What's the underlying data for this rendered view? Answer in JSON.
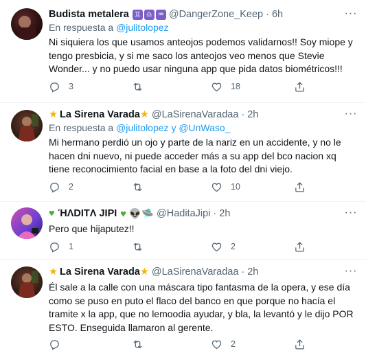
{
  "tweets": [
    {
      "name": "Budista metalera",
      "name_suffix_badges": [
        "♊",
        "♎",
        "♒"
      ],
      "handle": "@DangerZone_Keep",
      "time": "6h",
      "reply_prefix": "En respuesta a",
      "reply_to": [
        "@julitolopez"
      ],
      "reply_joiner": "",
      "text": "Ni siquiera los que usamos anteojos podemos validarnos!! Soy miope y tengo presbicia, y si me saco los anteojos veo menos que Stevie Wonder... y no puedo usar ninguna app que pida datos biométricos!!!",
      "replies": "3",
      "retweets": "",
      "likes": "18"
    },
    {
      "name_prefix": "★",
      "name": "La Sirena Varada",
      "name_suffix": "★",
      "handle": "@LaSirenaVaradaa",
      "time": "2h",
      "reply_prefix": "En respuesta a",
      "reply_to": [
        "@julitolopez",
        "@UnWaso_"
      ],
      "reply_joiner": "y",
      "text": "Mi hermano perdió un ojo y parte de la nariz en un accidente, y no le hacen dni nuevo, ni puede acceder más a su app del bco nacion xq tiene reconocimiento facial en base a la foto del dni viejo.",
      "replies": "2",
      "retweets": "",
      "likes": "10"
    },
    {
      "name_prefix": "♥",
      "name": "ΉΛDITΛ JIPI",
      "name_suffix": "♥ 👽🛸",
      "handle": "@HaditaJipi",
      "time": "2h",
      "text": "Pero que hijaputez!!",
      "replies": "1",
      "retweets": "",
      "likes": "2"
    },
    {
      "name_prefix": "★",
      "name": "La Sirena Varada",
      "name_suffix": "★",
      "handle": "@LaSirenaVaradaa",
      "time": "2h",
      "text": "Él sale a la calle con una máscara tipo fantasma de la opera, y ese día como se puso en puto el flaco del banco en que porque no hacía el tramite x la app, que no lemoodia ayudar, y bla, la levantó y le dijo POR ESTO. Enseguida llamaron al gerente.",
      "replies": "",
      "retweets": "",
      "likes": "2"
    }
  ],
  "dot": "·",
  "more_glyph": "···"
}
